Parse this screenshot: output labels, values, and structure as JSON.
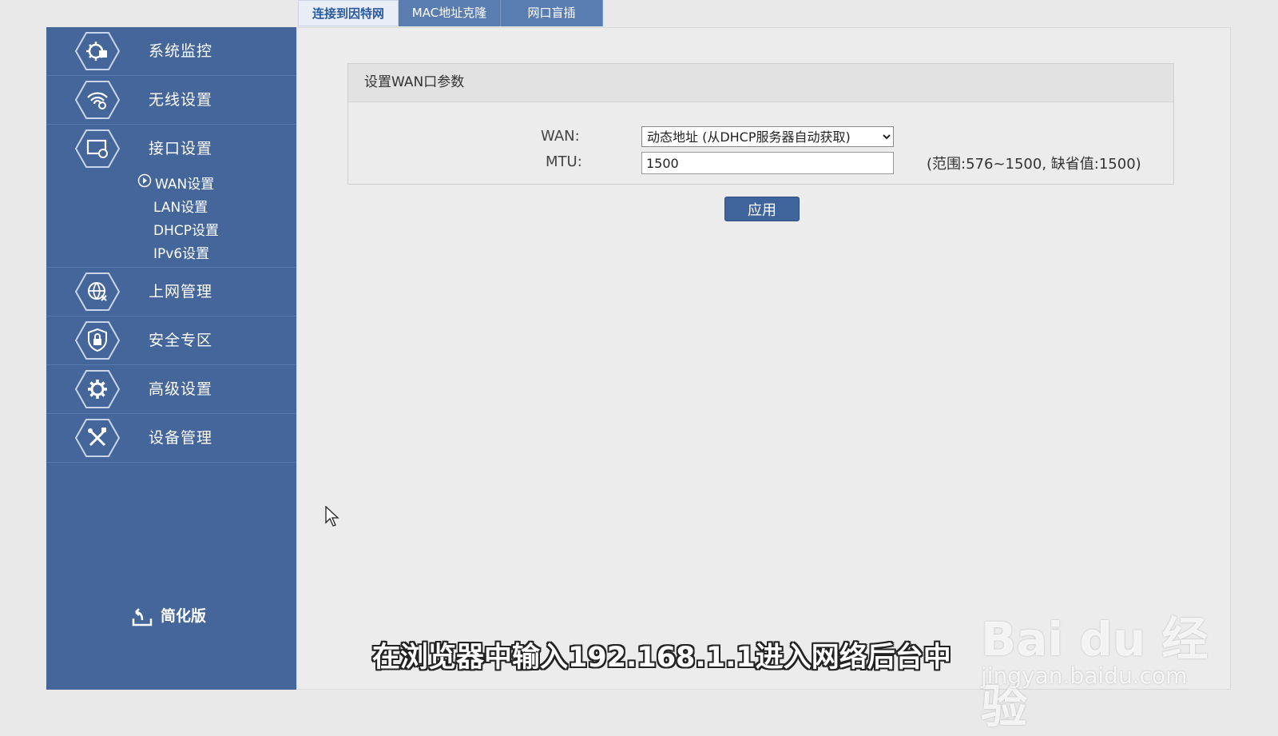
{
  "tabs": [
    {
      "label": "连接到因特网",
      "active": true
    },
    {
      "label": "MAC地址克隆",
      "active": false
    },
    {
      "label": "网口盲插",
      "active": false
    }
  ],
  "sidebar": {
    "items": [
      {
        "label": "系统监控",
        "icon": "monitor-icon"
      },
      {
        "label": "无线设置",
        "icon": "wireless-icon"
      },
      {
        "label": "接口设置",
        "icon": "interface-icon"
      },
      {
        "label": "上网管理",
        "icon": "globe-icon"
      },
      {
        "label": "安全专区",
        "icon": "shield-lock-icon"
      },
      {
        "label": "高级设置",
        "icon": "gear-icon"
      },
      {
        "label": "设备管理",
        "icon": "tools-icon"
      }
    ],
    "subitems": [
      "WAN设置",
      "LAN设置",
      "DHCP设置",
      "IPv6设置"
    ],
    "simple_label": "简化版"
  },
  "panel": {
    "title": "设置WAN口参数",
    "wan_label": "WAN:",
    "wan_value": "动态地址 (从DHCP服务器自动获取)",
    "mtu_label": "MTU:",
    "mtu_value": "1500",
    "mtu_hint": "(范围:576~1500, 缺省值:1500)"
  },
  "apply_label": "应用",
  "overlay": {
    "subtitle": "在浏览器中输入192.168.1.1进入网络后台中",
    "watermark_brand": "Bai du 经验",
    "watermark_url": "jingyan.baidu.com"
  },
  "colors": {
    "sidebar": "#44669a",
    "tab_inactive": "#5a7db1",
    "button": "#3f639b"
  }
}
